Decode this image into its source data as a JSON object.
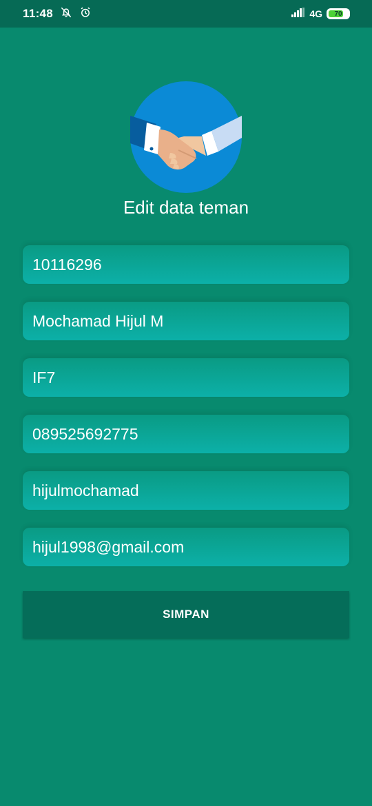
{
  "status_bar": {
    "time": "11:48",
    "network": "4G",
    "battery": "70",
    "icons": [
      "notifications-off-icon",
      "alarm-icon",
      "signal-icon",
      "battery-icon"
    ]
  },
  "screen": {
    "title": "Edit data teman",
    "logo": "handshake-icon"
  },
  "form": {
    "fields": [
      {
        "value": "10116296"
      },
      {
        "value": "Mochamad Hijul M"
      },
      {
        "value": "IF7"
      },
      {
        "value": "089525692775"
      },
      {
        "value": "hijulmochamad"
      },
      {
        "value": "hijul1998@gmail.com"
      }
    ],
    "save_label": "SIMPAN"
  },
  "colors": {
    "background": "#088a6e",
    "status_bar": "#066a55",
    "field_top": "#0a9b84",
    "field_bottom": "#0cb0a8",
    "button": "#056d59",
    "logo_circle": "#0b8ad6"
  }
}
